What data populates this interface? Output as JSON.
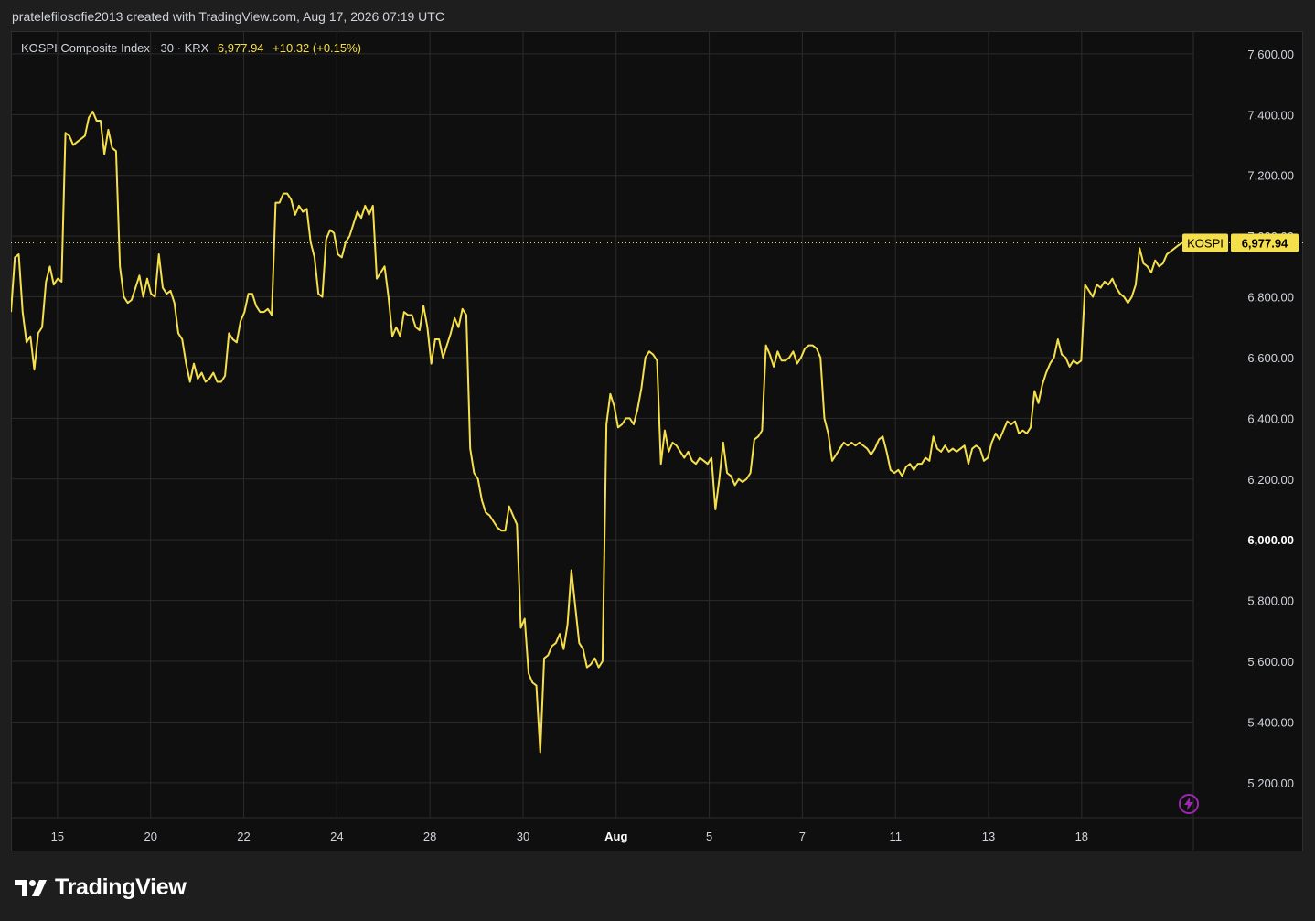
{
  "caption": "pratelefilosofie2013 created with TradingView.com, Aug 17, 2026 07:19 UTC",
  "legend": {
    "name": "KOSPI Composite Index",
    "interval": "30",
    "exchange": "KRX",
    "price": "6,977.94",
    "change": "+10.32 (+0.15%)",
    "dot": "·"
  },
  "brand": {
    "name": "TradingView"
  },
  "icons": {
    "bolt": "lightning-bolt-icon",
    "logo": "tradingview-logo-icon"
  },
  "colors": {
    "line": "#f5e04c",
    "background": "#0f0f0f",
    "grid": "#2b2b2b",
    "accent_purple": "#9c27b0"
  },
  "chart_data": {
    "type": "line",
    "grid": true,
    "ylim": [
      5085,
      7675
    ],
    "yticks": [
      5200,
      5400,
      5600,
      5800,
      6000,
      6200,
      6400,
      6600,
      6800,
      7000,
      7200,
      7400,
      7600
    ],
    "ytick_labels": [
      "5,200.00",
      "5,400.00",
      "5,600.00",
      "5,800.00",
      "6,000.00",
      "6,200.00",
      "6,400.00",
      "6,600.00",
      "6,800.00",
      "7,000.00",
      "7,200.00",
      "7,400.00",
      "7,600.00"
    ],
    "bold_tick": "6,000.00",
    "xlim": [
      0,
      127
    ],
    "xticks": [
      {
        "x": 5,
        "label": "15",
        "bold": false
      },
      {
        "x": 15,
        "label": "20",
        "bold": false
      },
      {
        "x": 25,
        "label": "22",
        "bold": false
      },
      {
        "x": 35,
        "label": "24",
        "bold": false
      },
      {
        "x": 45,
        "label": "28",
        "bold": false
      },
      {
        "x": 55,
        "label": "30",
        "bold": false
      },
      {
        "x": 65,
        "label": "Aug",
        "bold": true
      },
      {
        "x": 75,
        "label": "5",
        "bold": false
      },
      {
        "x": 85,
        "label": "7",
        "bold": false
      },
      {
        "x": 95,
        "label": "11",
        "bold": false
      },
      {
        "x": 105,
        "label": "13",
        "bold": false
      },
      {
        "x": 115,
        "label": "18",
        "bold": false
      }
    ],
    "series": [
      {
        "symbol": "KOSPI",
        "last_label": "6,977.94",
        "last": 6977.94,
        "values": [
          6750,
          6930,
          6940,
          6750,
          6650,
          6670,
          6560,
          6680,
          6700,
          6850,
          6900,
          6840,
          6860,
          6850,
          7340,
          7330,
          7300,
          7310,
          7320,
          7330,
          7390,
          7410,
          7380,
          7380,
          7270,
          7350,
          7290,
          7280,
          6900,
          6800,
          6780,
          6790,
          6830,
          6870,
          6800,
          6860,
          6810,
          6800,
          6940,
          6830,
          6810,
          6820,
          6780,
          6680,
          6660,
          6580,
          6520,
          6580,
          6530,
          6550,
          6520,
          6530,
          6550,
          6520,
          6520,
          6540,
          6680,
          6660,
          6650,
          6720,
          6750,
          6810,
          6810,
          6770,
          6750,
          6750,
          6760,
          6740,
          7110,
          7110,
          7140,
          7140,
          7120,
          7070,
          7100,
          7080,
          7090,
          6980,
          6930,
          6810,
          6800,
          6990,
          7020,
          7010,
          6940,
          6930,
          6980,
          7000,
          7040,
          7080,
          7060,
          7100,
          7070,
          7100,
          6860,
          6880,
          6900,
          6800,
          6670,
          6700,
          6670,
          6750,
          6740,
          6740,
          6700,
          6690,
          6770,
          6700,
          6580,
          6660,
          6660,
          6600,
          6640,
          6680,
          6730,
          6700,
          6760,
          6740,
          6300,
          6220,
          6200,
          6130,
          6090,
          6080,
          6060,
          6040,
          6030,
          6030,
          6110,
          6080,
          6050,
          5710,
          5740,
          5560,
          5530,
          5520,
          5300,
          5610,
          5620,
          5650,
          5660,
          5690,
          5640,
          5720,
          5900,
          5780,
          5660,
          5640,
          5580,
          5590,
          5610,
          5580,
          5600,
          6380,
          6480,
          6440,
          6370,
          6380,
          6400,
          6400,
          6380,
          6430,
          6500,
          6600,
          6620,
          6610,
          6590,
          6250,
          6360,
          6290,
          6320,
          6310,
          6290,
          6270,
          6290,
          6260,
          6250,
          6270,
          6260,
          6250,
          6270,
          6100,
          6200,
          6320,
          6220,
          6210,
          6180,
          6200,
          6190,
          6200,
          6220,
          6330,
          6340,
          6360,
          6640,
          6610,
          6570,
          6620,
          6590,
          6590,
          6600,
          6620,
          6580,
          6600,
          6630,
          6640,
          6640,
          6630,
          6600,
          6400,
          6350,
          6260,
          6280,
          6300,
          6320,
          6310,
          6320,
          6310,
          6320,
          6310,
          6300,
          6280,
          6300,
          6330,
          6340,
          6290,
          6230,
          6220,
          6230,
          6210,
          6240,
          6250,
          6230,
          6250,
          6250,
          6270,
          6260,
          6340,
          6300,
          6290,
          6310,
          6290,
          6300,
          6290,
          6300,
          6310,
          6250,
          6300,
          6310,
          6300,
          6260,
          6270,
          6320,
          6350,
          6330,
          6360,
          6390,
          6380,
          6390,
          6350,
          6360,
          6350,
          6370,
          6490,
          6450,
          6510,
          6550,
          6580,
          6600,
          6660,
          6610,
          6600,
          6570,
          6590,
          6580,
          6590,
          6840,
          6820,
          6800,
          6840,
          6830,
          6850,
          6840,
          6860,
          6830,
          6810,
          6800,
          6780,
          6800,
          6840,
          6960,
          6910,
          6900,
          6880,
          6920,
          6900,
          6910,
          6940,
          6950,
          6960,
          6970,
          6977.94
        ]
      }
    ]
  }
}
